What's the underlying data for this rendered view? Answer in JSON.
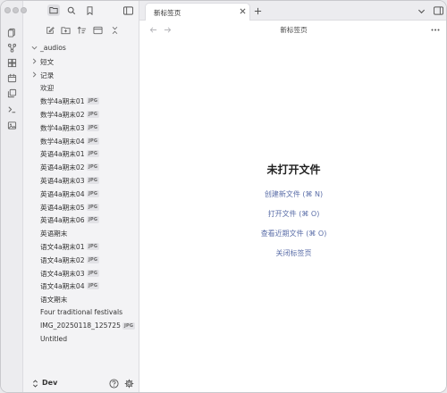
{
  "sidebar": {
    "tree": [
      {
        "label": "_audios",
        "kind": "folder",
        "expanded": true,
        "badge": ""
      },
      {
        "label": "短文",
        "kind": "folder",
        "expanded": false,
        "badge": ""
      },
      {
        "label": "记录",
        "kind": "folder",
        "expanded": false,
        "badge": ""
      },
      {
        "label": "欢迎",
        "kind": "file",
        "badge": ""
      },
      {
        "label": "数学4a期末01",
        "kind": "file",
        "badge": "JPG"
      },
      {
        "label": "数学4a期末02",
        "kind": "file",
        "badge": "JPG"
      },
      {
        "label": "数学4a期末03",
        "kind": "file",
        "badge": "JPG"
      },
      {
        "label": "数学4a期末04",
        "kind": "file",
        "badge": "JPG"
      },
      {
        "label": "英语4a期末01",
        "kind": "file",
        "badge": "JPG"
      },
      {
        "label": "英语4a期末02",
        "kind": "file",
        "badge": "JPG"
      },
      {
        "label": "英语4a期末03",
        "kind": "file",
        "badge": "JPG"
      },
      {
        "label": "英语4a期末04",
        "kind": "file",
        "badge": "JPG"
      },
      {
        "label": "英语4a期末05",
        "kind": "file",
        "badge": "JPG"
      },
      {
        "label": "英语4a期末06",
        "kind": "file",
        "badge": "JPG"
      },
      {
        "label": "英语期末",
        "kind": "file",
        "badge": ""
      },
      {
        "label": "语文4a期末01",
        "kind": "file",
        "badge": "JPG"
      },
      {
        "label": "语文4a期末02",
        "kind": "file",
        "badge": "JPG"
      },
      {
        "label": "语文4a期末03",
        "kind": "file",
        "badge": "JPG"
      },
      {
        "label": "语文4a期末04",
        "kind": "file",
        "badge": "JPG"
      },
      {
        "label": "语文期末",
        "kind": "file",
        "badge": ""
      },
      {
        "label": "Four traditional festivals",
        "kind": "file",
        "badge": ""
      },
      {
        "label": "IMG_20250118_125725",
        "kind": "file",
        "badge": "JPG"
      },
      {
        "label": "Untitled",
        "kind": "file",
        "badge": ""
      }
    ],
    "vault_name": "Dev"
  },
  "tabs": [
    {
      "label": "新标签页",
      "active": true
    }
  ],
  "main": {
    "nav_title": "新标签页",
    "empty_title": "未打开文件",
    "actions": [
      "创建新文件 (⌘ N)",
      "打开文件 (⌘ O)",
      "查看近期文件 (⌘ O)",
      "关闭标签页"
    ]
  },
  "icons": [
    "files-icon",
    "search-icon",
    "bookmark-icon",
    "sidebar-toggle-icon",
    "open-quick-switcher-icon",
    "graph-icon",
    "canvas-icon",
    "calendar-icon",
    "templates-icon",
    "terminal-icon",
    "image-icon",
    "new-note-icon",
    "new-folder-icon",
    "sort-icon",
    "collapse-icon",
    "expand-all-icon",
    "help-icon",
    "settings-icon",
    "close-icon",
    "plus-icon",
    "chevron-down-icon",
    "back-arrow-icon",
    "forward-arrow-icon",
    "more-options-icon"
  ],
  "colors": {
    "accent_link": "#5b6ea8",
    "sidebar_bg": "#f3f3f5",
    "main_bg": "#ffffff"
  }
}
